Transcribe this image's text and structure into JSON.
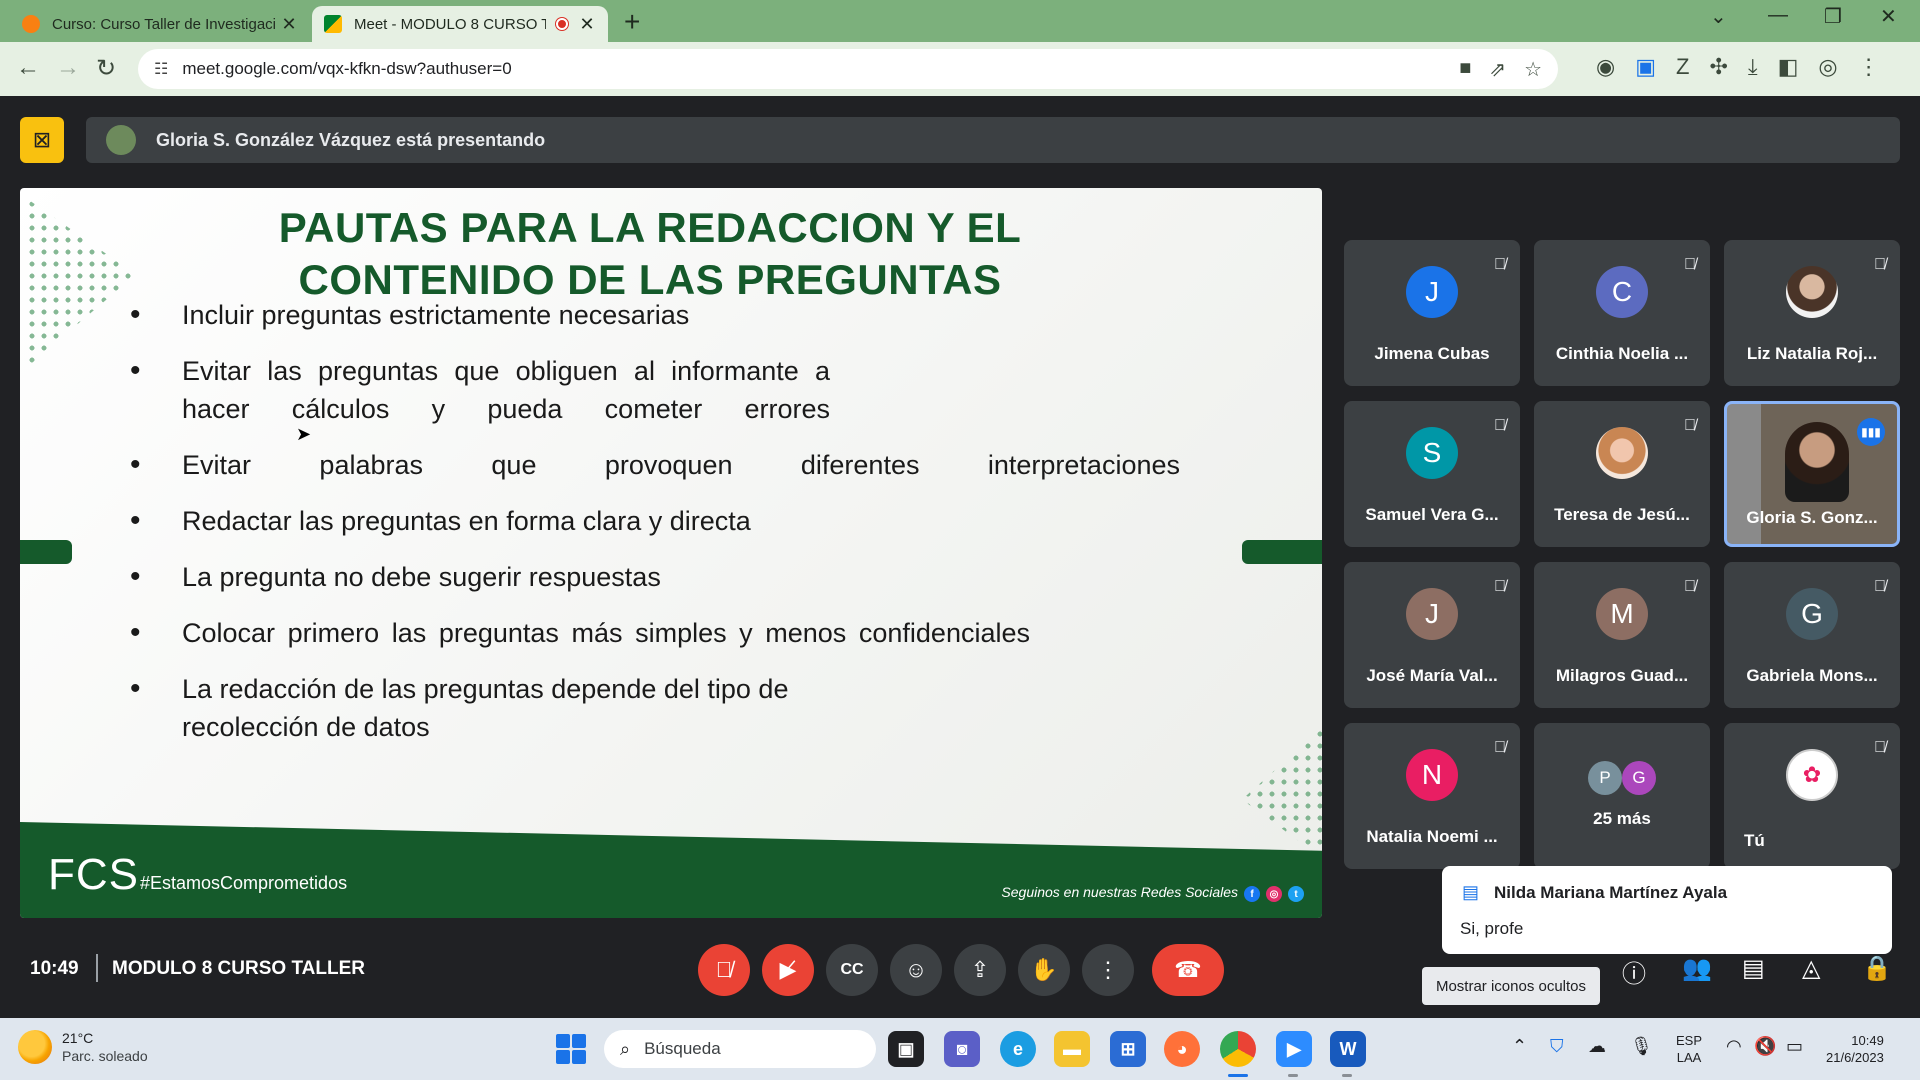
{
  "browser": {
    "tabs": [
      {
        "title": "Curso: Curso Taller de Investigaci"
      },
      {
        "title": "Meet - MODULO 8 CURSO T"
      }
    ],
    "url": "meet.google.com/vqx-kfkn-dsw?authuser=0"
  },
  "meet": {
    "presenter_text": "Gloria S. González Vázquez está presentando",
    "meeting_time": "10:49",
    "meeting_name": "MODULO 8 CURSO TALLER",
    "tooltip": "Mostrar iconos ocultos"
  },
  "slide": {
    "title_line1": "PAUTAS PARA LA REDACCION Y EL",
    "title_line2": "CONTENIDO DE LAS PREGUNTAS",
    "bullets": [
      "Incluir preguntas estrictamente necesarias",
      "Evitar las preguntas que obliguen al informante a hacer cálculos y pueda cometer errores",
      "Evitar palabras que provoquen diferentes interpretaciones",
      "Redactar las preguntas en forma clara y directa",
      "La pregunta no debe sugerir respuestas",
      "Colocar primero las preguntas más simples y menos confidenciales",
      "La redacción de las preguntas depende del tipo de recolección de datos"
    ],
    "footer_logo": "FCS",
    "footer_hashtag": "#EstamosComprometidos",
    "footer_social": "Seguinos en nuestras Redes Sociales"
  },
  "participants": [
    {
      "initial": "J",
      "name": "Jimena Cubas",
      "color": "#1a73e8"
    },
    {
      "initial": "C",
      "name": "Cinthia Noelia ...",
      "color": "#5c6bc0"
    },
    {
      "initial": "",
      "name": "Liz Natalia Roj...",
      "color": "#8d6e63"
    },
    {
      "initial": "S",
      "name": "Samuel Vera G...",
      "color": "#0097a7"
    },
    {
      "initial": "",
      "name": "Teresa de Jesú...",
      "color": "#e9a27c"
    },
    {
      "initial": "",
      "name": "Gloria S. Gonz...",
      "color": "#5f5548"
    },
    {
      "initial": "J",
      "name": "José María Val...",
      "color": "#8d6e63"
    },
    {
      "initial": "M",
      "name": "Milagros Guad...",
      "color": "#8d6e63"
    },
    {
      "initial": "G",
      "name": "Gabriela Mons...",
      "color": "#455a64"
    },
    {
      "initial": "N",
      "name": "Natalia Noemi ...",
      "color": "#e91e63"
    },
    {
      "initial": "",
      "name": "25 más",
      "color": "#3c4043"
    },
    {
      "initial": "",
      "name": "Tú",
      "color": "#ffffff"
    }
  ],
  "more_avatars": [
    "P",
    "G"
  ],
  "chat": {
    "from": "Nilda Mariana Martínez Ayala",
    "message": "Si, profe"
  },
  "taskbar": {
    "temp": "21°C",
    "weather": "Parc. soleado",
    "search_placeholder": "Búsqueda",
    "lang1": "ESP",
    "lang2": "LAA",
    "time": "10:49",
    "date": "21/6/2023"
  }
}
